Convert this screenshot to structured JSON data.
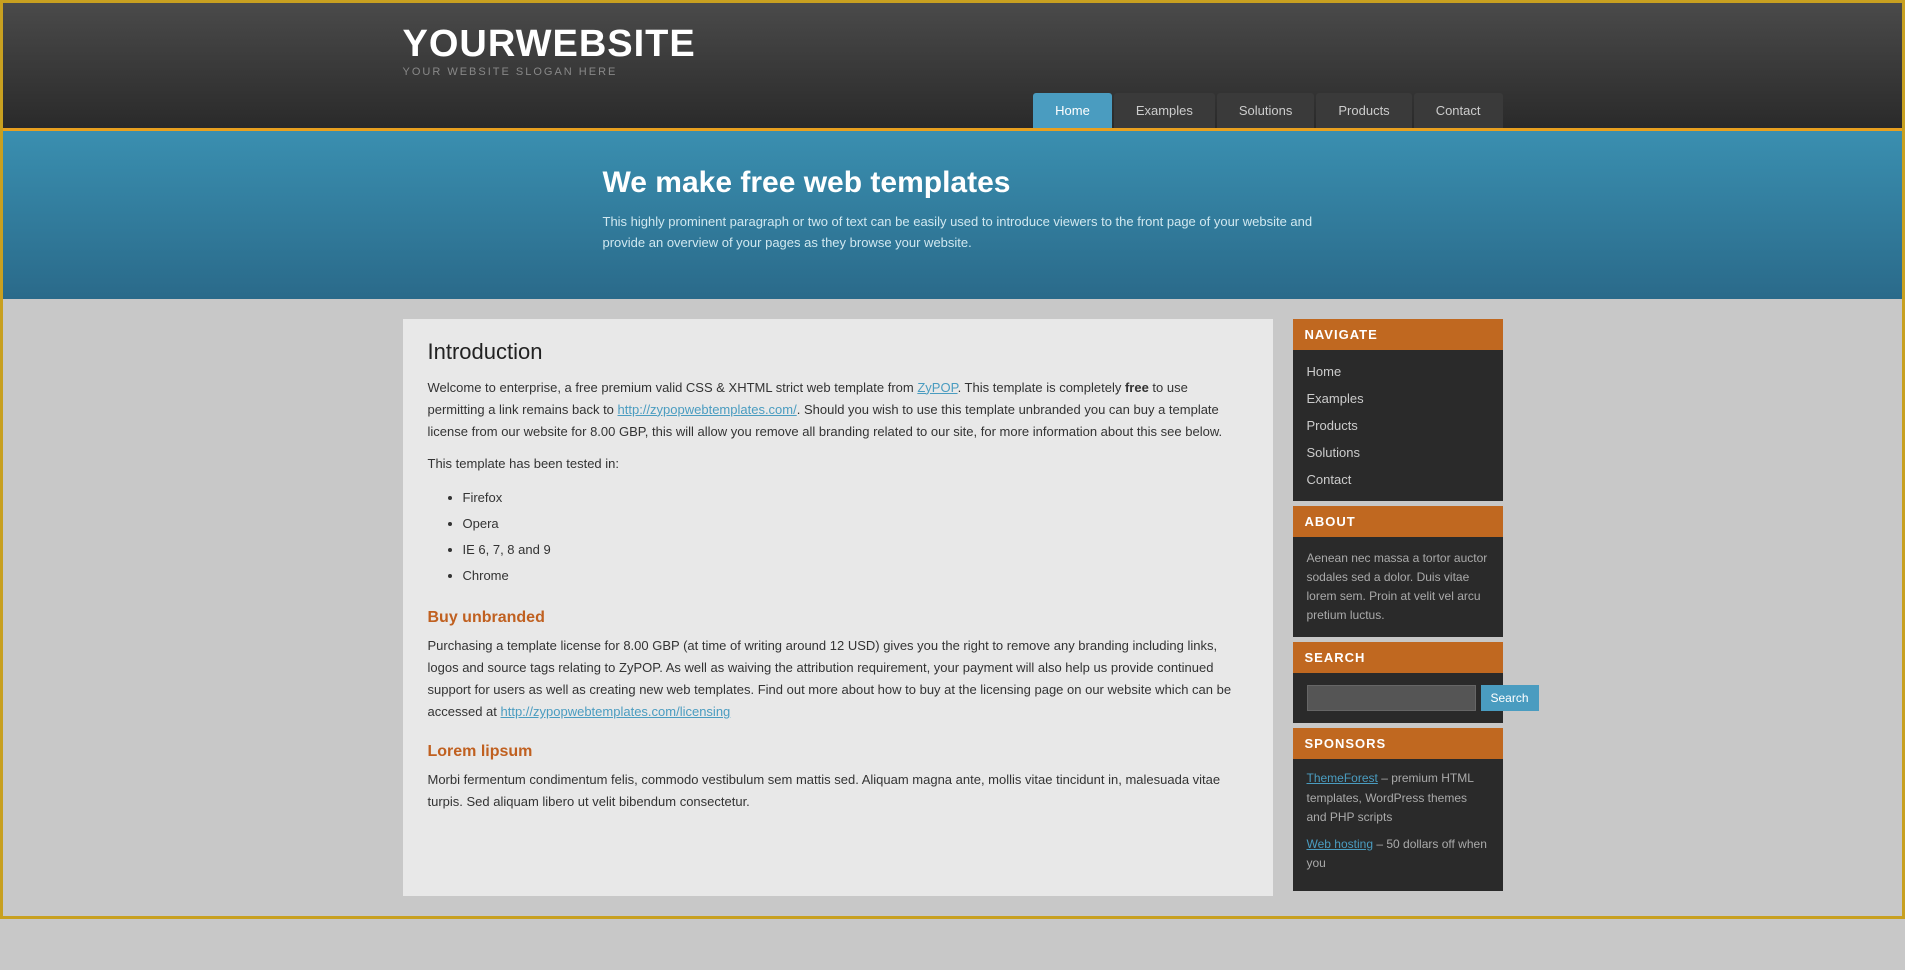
{
  "header": {
    "logo_title": "YOURWEBSITE",
    "logo_slogan": "YOUR WEBSITE SLOGAN HERE",
    "nav_items": [
      {
        "label": "Home",
        "active": true
      },
      {
        "label": "Examples",
        "active": false
      },
      {
        "label": "Solutions",
        "active": false
      },
      {
        "label": "Products",
        "active": false
      },
      {
        "label": "Contact",
        "active": false
      }
    ]
  },
  "hero": {
    "heading": "We make free web templates",
    "description": "This highly prominent paragraph or two of text can be easily used to introduce viewers to the front page of your website and provide an overview of your pages as they browse your website."
  },
  "content": {
    "intro_heading": "Introduction",
    "intro_p1": "Welcome to enterprise, a free premium valid CSS & XHTML strict web template from ZyPOP. This template is completely ",
    "intro_p1_bold": "free",
    "intro_p1_mid": " to use permitting a link remains back to ",
    "intro_link1": "http://zypopwebtemplates.com/",
    "intro_p1_end": ". Should you wish to use this template unbranded you can buy a template license from our website for 8.00 GBP, this will allow you remove all branding related to our site, for more information about this see below.",
    "intro_tested": "This template has been tested in:",
    "tested_items": [
      "Firefox",
      "Opera",
      "IE 6, 7, 8 and 9",
      "Chrome"
    ],
    "buy_heading": "Buy unbranded",
    "buy_text": "Purchasing a template license for 8.00 GBP (at time of writing around 12 USD) gives you the right to remove any branding including links, logos and source tags relating to ZyPOP. As well as waiving the attribution requirement, your payment will also help us provide continued support for users as well as creating new web templates. Find out more about how to buy at the licensing page on our website which can be accessed at ",
    "buy_link": "http://zypopwebtemplates.com/licensing",
    "lorem_heading": "Lorem lipsum",
    "lorem_text": "Morbi fermentum condimentum felis, commodo vestibulum sem mattis sed. Aliquam magna ante, mollis vitae tincidunt in, malesuada vitae turpis. Sed aliquam libero ut velit bibendum consectetur."
  },
  "sidebar": {
    "navigate_title": "NAVIGATE",
    "nav_items": [
      "Home",
      "Examples",
      "Products",
      "Solutions",
      "Contact"
    ],
    "about_title": "ABOUT",
    "about_text": "Aenean nec massa a tortor auctor sodales sed a dolor. Duis vitae lorem sem. Proin at velit vel arcu pretium luctus.",
    "search_title": "SEARCH",
    "search_placeholder": "",
    "search_button": "Search",
    "sponsors_title": "SPONSORS",
    "sponsor1_link": "ThemeForest",
    "sponsor1_text": " – premium HTML templates, WordPress themes and PHP scripts",
    "sponsor2_link": "Web hosting",
    "sponsor2_text": " – 50 dollars off when you"
  }
}
